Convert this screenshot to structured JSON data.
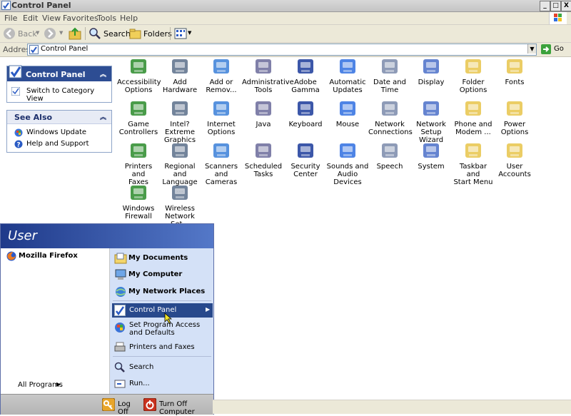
{
  "window": {
    "title": "Control Panel",
    "buttons": {
      "minimize": "_",
      "maximize": "□",
      "close": "X"
    }
  },
  "menubar": [
    "File",
    "Edit",
    "View",
    "Favorites",
    "Tools",
    "Help"
  ],
  "toolbar": {
    "back": "Back",
    "search": "Search",
    "folders": "Folders"
  },
  "address": {
    "label": "Address",
    "value": "Control Panel",
    "go": "Go"
  },
  "left_panel": {
    "control_panel": {
      "title": "Control Panel",
      "items": [
        "Switch to Category View"
      ]
    },
    "see_also": {
      "title": "See Also",
      "items": [
        "Windows Update",
        "Help and Support"
      ]
    }
  },
  "icons": [
    {
      "line1": "Accessibility",
      "line2": "Options"
    },
    {
      "line1": "Add Hardware",
      "line2": ""
    },
    {
      "line1": "Add or",
      "line2": "Remov..."
    },
    {
      "line1": "Administrative",
      "line2": "Tools"
    },
    {
      "line1": "Adobe Gamma",
      "line2": ""
    },
    {
      "line1": "Automatic",
      "line2": "Updates"
    },
    {
      "line1": "Date and Time",
      "line2": ""
    },
    {
      "line1": "Display",
      "line2": ""
    },
    {
      "line1": "Folder Options",
      "line2": ""
    },
    {
      "line1": "Fonts",
      "line2": ""
    },
    {
      "line1": "Game",
      "line2": "Controllers"
    },
    {
      "line1": "Intel? Extreme",
      "line2": "Graphics"
    },
    {
      "line1": "Internet",
      "line2": "Options"
    },
    {
      "line1": "Java",
      "line2": ""
    },
    {
      "line1": "Keyboard",
      "line2": ""
    },
    {
      "line1": "Mouse",
      "line2": ""
    },
    {
      "line1": "Network",
      "line2": "Connections"
    },
    {
      "line1": "Network Setup",
      "line2": "Wizard"
    },
    {
      "line1": "Phone and",
      "line2": "Modem ..."
    },
    {
      "line1": "Power Options",
      "line2": ""
    },
    {
      "line1": "Printers and",
      "line2": "Faxes"
    },
    {
      "line1": "Regional and",
      "line2": "Language ..."
    },
    {
      "line1": "Scanners and",
      "line2": "Cameras"
    },
    {
      "line1": "Scheduled",
      "line2": "Tasks"
    },
    {
      "line1": "Security",
      "line2": "Center"
    },
    {
      "line1": "Sounds and",
      "line2": "Audio Devices"
    },
    {
      "line1": "Speech",
      "line2": ""
    },
    {
      "line1": "System",
      "line2": ""
    },
    {
      "line1": "Taskbar and",
      "line2": "Start Menu"
    },
    {
      "line1": "User Accounts",
      "line2": ""
    },
    {
      "line1": "Windows",
      "line2": "Firewall"
    },
    {
      "line1": "Wireless",
      "line2": "Network Set..."
    }
  ],
  "start_menu": {
    "user": "User",
    "pinned": [
      "Mozilla Firefox"
    ],
    "all_programs": "All Programs",
    "right": {
      "my_documents": "My Documents",
      "my_computer": "My Computer",
      "my_network_places": "My Network Places",
      "control_panel": "Control Panel",
      "set_program_access": "Set Program Access and Defaults",
      "printers_and_faxes": "Printers and Faxes",
      "search": "Search",
      "run": "Run..."
    },
    "log_off": "Log Off",
    "turn_off": "Turn Off Computer"
  },
  "colors": {
    "title_active": "#2d4d93",
    "highlight": "#28498c",
    "start_header": "#1f3a8a"
  }
}
